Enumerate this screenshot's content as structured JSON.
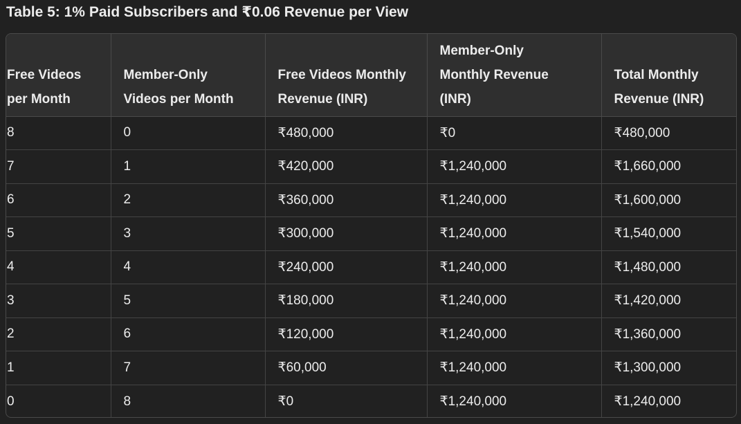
{
  "title": "Table 5: 1% Paid Subscribers and ₹0.06 Revenue per View",
  "columns": [
    {
      "line1": "Free Videos",
      "line2": "per Month",
      "line3": ""
    },
    {
      "line1": "Member-Only",
      "line2": "Videos per Month",
      "line3": ""
    },
    {
      "line1": "Free Videos Monthly",
      "line2": "Revenue (INR)",
      "line3": ""
    },
    {
      "line1": "Member-Only",
      "line2": "Monthly Revenue",
      "line3": "(INR)"
    },
    {
      "line1": "Total Monthly",
      "line2": "Revenue (INR)",
      "line3": ""
    }
  ],
  "rows": [
    [
      "8",
      "0",
      "₹480,000",
      "₹0",
      "₹480,000"
    ],
    [
      "7",
      "1",
      "₹420,000",
      "₹1,240,000",
      "₹1,660,000"
    ],
    [
      "6",
      "2",
      "₹360,000",
      "₹1,240,000",
      "₹1,600,000"
    ],
    [
      "5",
      "3",
      "₹300,000",
      "₹1,240,000",
      "₹1,540,000"
    ],
    [
      "4",
      "4",
      "₹240,000",
      "₹1,240,000",
      "₹1,480,000"
    ],
    [
      "3",
      "5",
      "₹180,000",
      "₹1,240,000",
      "₹1,420,000"
    ],
    [
      "2",
      "6",
      "₹120,000",
      "₹1,240,000",
      "₹1,360,000"
    ],
    [
      "1",
      "7",
      "₹60,000",
      "₹1,240,000",
      "₹1,300,000"
    ],
    [
      "0",
      "8",
      "₹0",
      "₹1,240,000",
      "₹1,240,000"
    ]
  ]
}
